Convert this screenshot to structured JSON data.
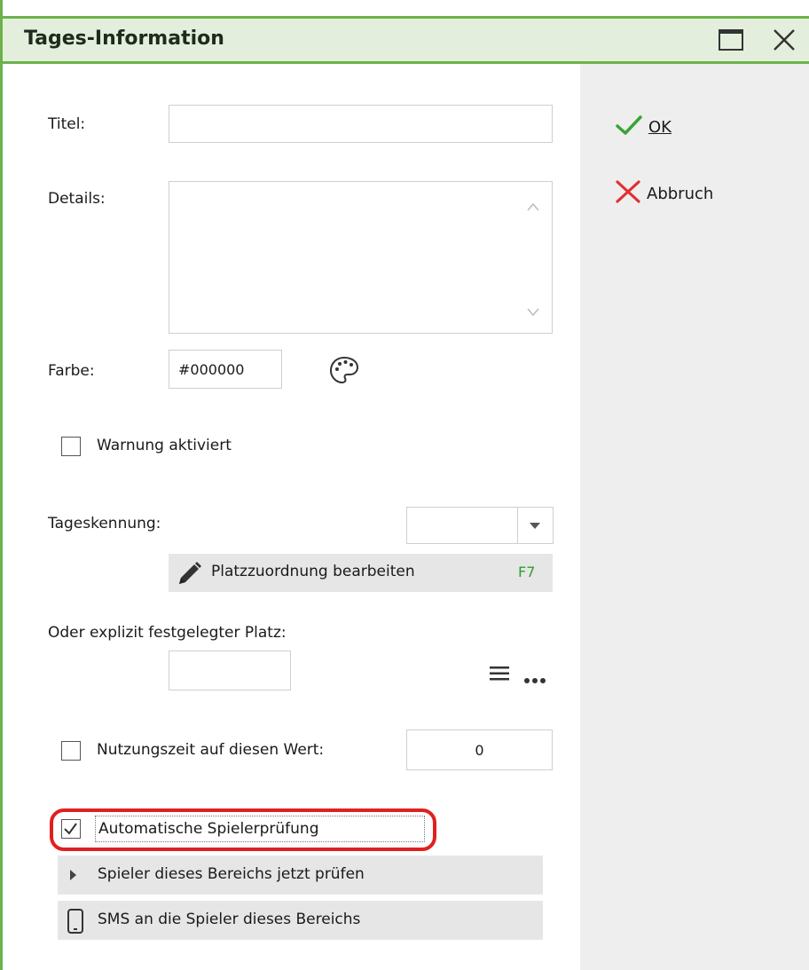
{
  "window": {
    "title": "Tages-Information"
  },
  "actions": {
    "ok_label": "OK",
    "cancel_label": "Abbruch"
  },
  "form": {
    "titel_label": "Titel:",
    "titel_value": "",
    "details_label": "Details:",
    "details_value": "",
    "farbe_label": "Farbe:",
    "farbe_value": "#000000",
    "warnung_label": "Warnung aktiviert",
    "warnung_checked": false,
    "tageskennung_label": "Tageskennung:",
    "tageskennung_value": "",
    "platzzuordnung_label": "Platzzuordnung bearbeiten",
    "platzzuordnung_shortcut": "F7",
    "platz_label": "Oder explizit festgelegter Platz:",
    "platz_value": "",
    "nutzungszeit_label": "Nutzungszeit auf diesen Wert:",
    "nutzungszeit_checked": false,
    "nutzungszeit_value": "0",
    "auto_check_label": "Automatische Spielerprüfung",
    "auto_check_checked": true,
    "check_now_label": "Spieler dieses Bereichs jetzt prüfen",
    "sms_label": "SMS an die Spieler dieses Bereichs"
  },
  "colors": {
    "accent_green": "#6cb24a",
    "titlebar_bg": "#e3efdc",
    "highlight_red": "#e02020",
    "ok_check": "#3aa335",
    "cancel_x": "#e03030",
    "shortcut_green": "#2e9e2e"
  },
  "icons": {
    "maximize": "maximize-icon",
    "close": "close-icon",
    "ok": "checkmark-icon",
    "cancel": "x-icon",
    "palette": "palette-icon",
    "pencil": "pencil-icon",
    "list": "list-icon",
    "more": "more-icon",
    "expand": "triangle-right-icon",
    "phone": "phone-icon"
  }
}
